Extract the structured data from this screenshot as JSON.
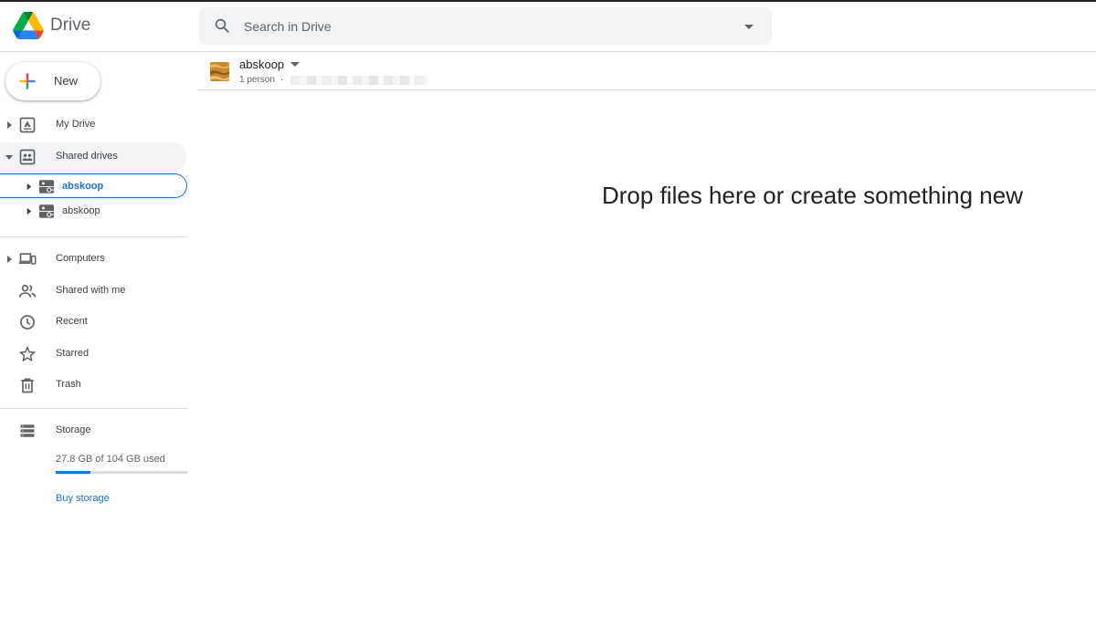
{
  "app": {
    "name": "Drive"
  },
  "search": {
    "placeholder": "Search in Drive"
  },
  "new_button": {
    "label": "New"
  },
  "sidebar": {
    "my_drive": "My Drive",
    "shared_drives": "Shared drives",
    "shared_drive_items": [
      {
        "label": "abskoop",
        "selected": true
      },
      {
        "label": "abskoop",
        "selected": false
      }
    ],
    "computers": "Computers",
    "shared_with_me": "Shared with me",
    "recent": "Recent",
    "starred": "Starred",
    "trash": "Trash",
    "storage": {
      "label": "Storage",
      "usage_text": "27.8 GB of 104 GB used",
      "used_fraction": 0.267,
      "buy_label": "Buy storage"
    }
  },
  "main": {
    "drive_name": "abskoop",
    "members": "1 person",
    "meta_separator": "·",
    "empty_message": "Drop files here or create something new"
  },
  "colors": {
    "accent": "#1a73e8",
    "text": "#3c4043",
    "muted": "#5f6368",
    "divider": "#dadce0",
    "search_bg": "#f1f3f4"
  }
}
